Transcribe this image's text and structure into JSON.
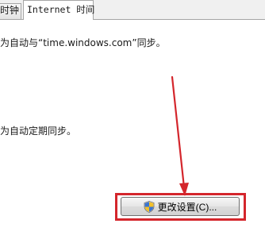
{
  "tabs": [
    {
      "label": "时钟",
      "active": false
    },
    {
      "label": "Internet 时间",
      "active": true
    }
  ],
  "content": {
    "sync_status_text": "为自动与“time.windows.com”同步。",
    "schedule_text": "为自动定期同步。"
  },
  "buttons": {
    "change_settings_label": "更改设置(C)..."
  },
  "colors": {
    "annotation": "#d4262c"
  },
  "icons": {
    "change_settings": "uac-shield-icon"
  }
}
